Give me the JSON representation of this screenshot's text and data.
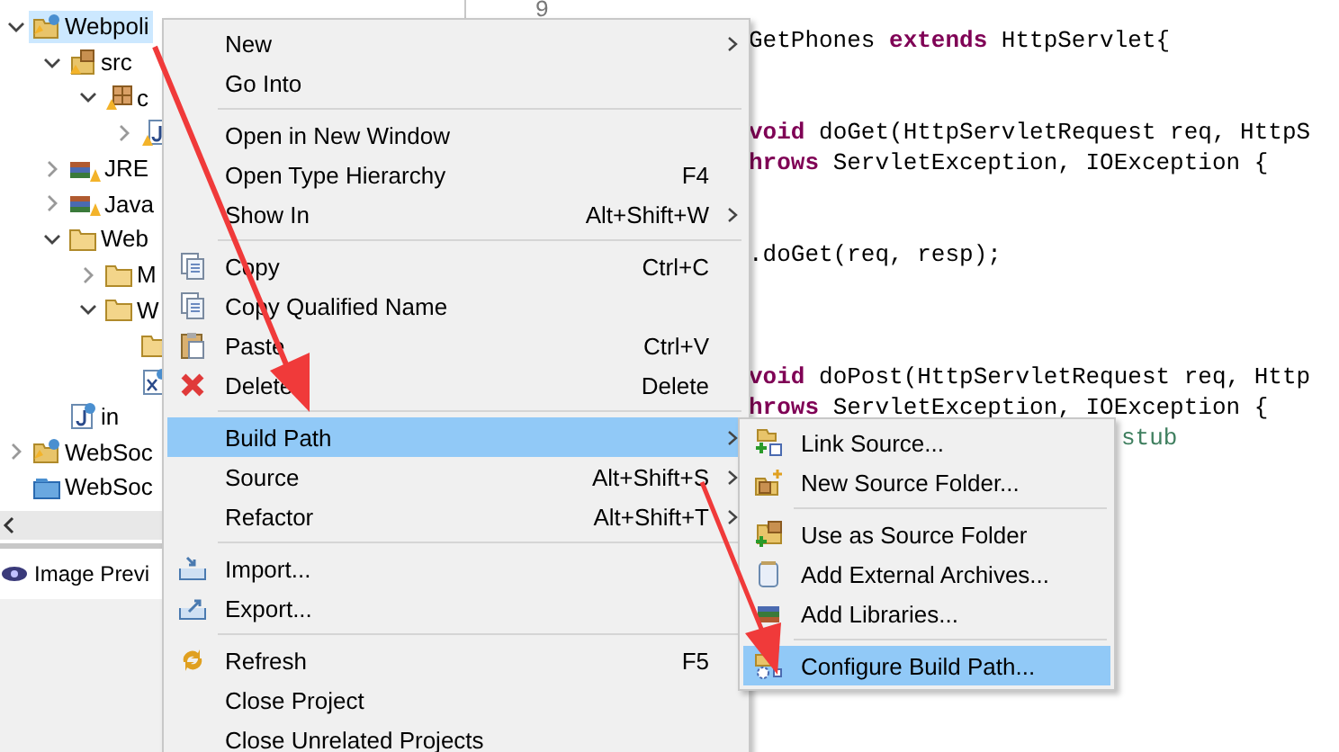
{
  "tree": [
    {
      "label": "Webpoli",
      "kind": "project",
      "expanded": true,
      "selected": true,
      "children": [
        {
          "label": "src",
          "kind": "source-folder",
          "expanded": true,
          "selected": false,
          "children": [
            {
              "label": "c",
              "kind": "package",
              "expanded": true,
              "selected": false,
              "children": [
                {
                  "kind": "java-file",
                  "expanded": false,
                  "selected": false
                }
              ]
            }
          ]
        },
        {
          "label": "JRE",
          "kind": "library",
          "expanded": false,
          "selected": false
        },
        {
          "label": "Java",
          "kind": "library",
          "expanded": false,
          "selected": false
        },
        {
          "label": "Web",
          "kind": "folder",
          "expanded": true,
          "selected": false,
          "children": [
            {
              "label": "M",
              "kind": "folder",
              "expanded": false,
              "selected": false
            },
            {
              "label": "W",
              "kind": "folder",
              "expanded": true,
              "selected": false,
              "children": [
                {
                  "kind": "folder",
                  "selected": false
                },
                {
                  "kind": "xml-file",
                  "selected": false
                }
              ]
            }
          ]
        },
        {
          "label": "in",
          "kind": "jsp-file",
          "selected": false
        }
      ]
    },
    {
      "label": "WebSoc",
      "kind": "project",
      "expanded": false,
      "selected": false
    },
    {
      "label": "WebSoc",
      "kind": "closed-project",
      "selected": false
    }
  ],
  "bottom_panel": {
    "tab": "Image Previ"
  },
  "editor": {
    "lines": [
      {
        "number": "9"
      },
      {
        "segments": [
          {
            "text": "GetPhones ",
            "kind": "plain"
          },
          {
            "text": "extends",
            "kind": "keyword"
          },
          {
            "text": " HttpServlet{",
            "kind": "plain"
          }
        ]
      },
      {
        "kind": "blank"
      },
      {
        "kind": "blank"
      },
      {
        "segments": [
          {
            "text": "void",
            "kind": "keyword"
          },
          {
            "text": " doGet(HttpServletRequest req, HttpS",
            "kind": "plain"
          }
        ]
      },
      {
        "segments": [
          {
            "text": "hrows",
            "kind": "keyword"
          },
          {
            "text": " ServletException, IOException {",
            "kind": "plain"
          }
        ]
      },
      {
        "kind": "blank"
      },
      {
        "kind": "blank"
      },
      {
        "segments": [
          {
            "text": ".doGet(req, resp);",
            "kind": "plain"
          }
        ]
      },
      {
        "kind": "blank"
      },
      {
        "kind": "blank"
      },
      {
        "kind": "blank"
      },
      {
        "segments": [
          {
            "text": "void",
            "kind": "keyword"
          },
          {
            "text": " doPost(HttpServletRequest req, Http",
            "kind": "plain"
          }
        ]
      },
      {
        "segments": [
          {
            "text": "hrows",
            "kind": "keyword"
          },
          {
            "text": " ServletException, IOException {",
            "kind": "plain"
          }
        ]
      },
      {
        "segments": [
          {
            "text": "stub",
            "kind": "comment"
          }
        ]
      }
    ]
  },
  "context_menu": {
    "groups": [
      [
        {
          "label": "New",
          "submenu": true,
          "selected": false
        },
        {
          "label": "Go Into",
          "submenu": false,
          "selected": false
        }
      ],
      [
        {
          "label": "Open in New Window",
          "submenu": false,
          "selected": false
        },
        {
          "label": "Open Type Hierarchy",
          "shortcut": "F4",
          "submenu": false,
          "selected": false
        },
        {
          "label": "Show In",
          "shortcut": "Alt+Shift+W",
          "submenu": true,
          "selected": false
        }
      ],
      [
        {
          "label": "Copy",
          "shortcut": "Ctrl+C",
          "submenu": false,
          "selected": false
        },
        {
          "label": "Copy Qualified Name",
          "submenu": false,
          "selected": false
        },
        {
          "label": "Paste",
          "shortcut": "Ctrl+V",
          "submenu": false,
          "selected": false
        },
        {
          "label": "Delete",
          "shortcut": "Delete",
          "submenu": false,
          "selected": false
        }
      ],
      [
        {
          "label": "Build Path",
          "submenu": true,
          "selected": true
        },
        {
          "label": "Source",
          "shortcut": "Alt+Shift+S",
          "submenu": true,
          "selected": false
        },
        {
          "label": "Refactor",
          "shortcut": "Alt+Shift+T",
          "submenu": true,
          "selected": false
        }
      ],
      [
        {
          "label": "Import...",
          "submenu": false,
          "selected": false
        },
        {
          "label": "Export...",
          "submenu": false,
          "selected": false
        }
      ],
      [
        {
          "label": "Refresh",
          "shortcut": "F5",
          "submenu": false,
          "selected": false
        },
        {
          "label": "Close Project",
          "submenu": false,
          "selected": false
        },
        {
          "label": "Close Unrelated Projects",
          "submenu": false,
          "selected": false
        }
      ]
    ]
  },
  "submenu": {
    "groups": [
      [
        {
          "label": "Link Source...",
          "selected": false
        },
        {
          "label": "New Source Folder...",
          "selected": false
        }
      ],
      [
        {
          "label": "Use as Source Folder",
          "selected": false
        },
        {
          "label": "Add External Archives...",
          "selected": false
        },
        {
          "label": "Add Libraries...",
          "selected": false
        }
      ],
      [
        {
          "label": "Configure Build Path...",
          "selected": true
        }
      ]
    ]
  }
}
